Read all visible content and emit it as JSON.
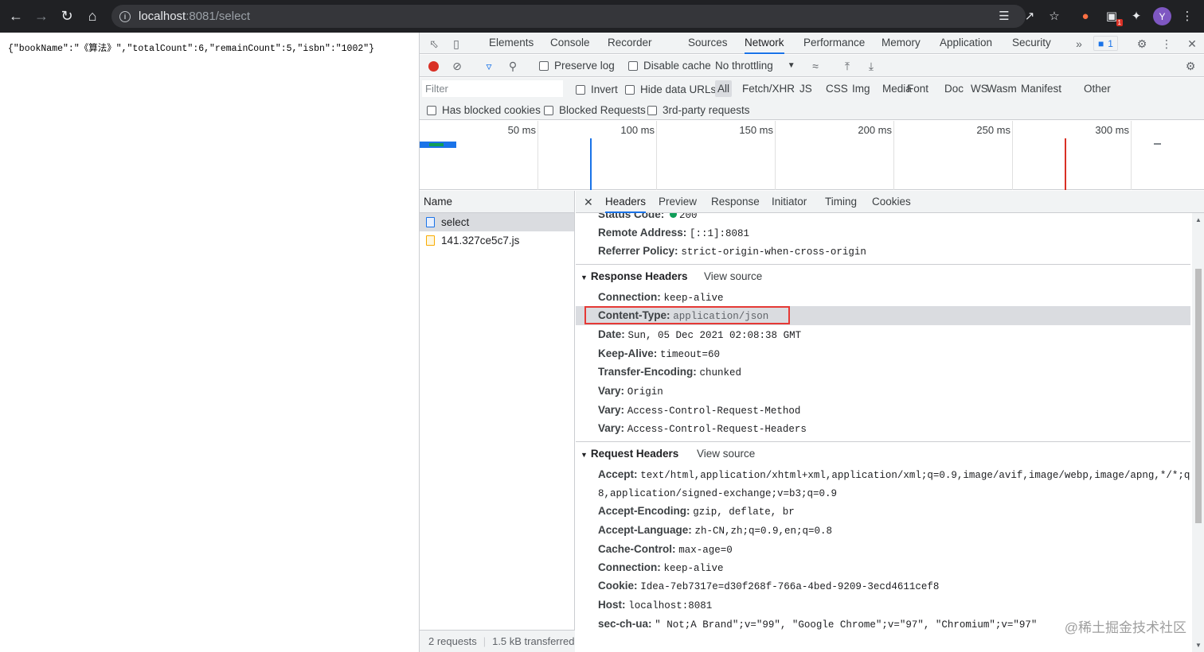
{
  "browser": {
    "url_host": "localhost",
    "url_path": ":8081/select",
    "avatar_letter": "Y",
    "ext_badge": "1"
  },
  "page": {
    "json_text": "{\"bookName\":\"《算法》\",\"totalCount\":6,\"remainCount\":5,\"isbn\":\"1002\"}"
  },
  "devtools": {
    "tabs": [
      "Elements",
      "Console",
      "Recorder",
      "Sources",
      "Network",
      "Performance",
      "Memory",
      "Application",
      "Security"
    ],
    "active_tab": "Network",
    "issues_count": "1",
    "toolbar": {
      "preserve_log": "Preserve log",
      "disable_cache": "Disable cache",
      "throttling": "No throttling"
    },
    "filter": {
      "placeholder": "Filter",
      "invert": "Invert",
      "hide_data_urls": "Hide data URLs",
      "types": [
        "All",
        "Fetch/XHR",
        "JS",
        "CSS",
        "Img",
        "Media",
        "Font",
        "Doc",
        "WS",
        "Wasm",
        "Manifest",
        "Other"
      ],
      "selected_type": "All",
      "has_blocked_cookies": "Has blocked cookies",
      "blocked_requests": "Blocked Requests",
      "third_party": "3rd-party requests"
    },
    "timeline_ticks": [
      "50 ms",
      "100 ms",
      "150 ms",
      "200 ms",
      "250 ms",
      "300 ms"
    ],
    "requests": {
      "column": "Name",
      "items": [
        {
          "name": "select",
          "type": "doc"
        },
        {
          "name": "141.327ce5c7.js",
          "type": "js"
        }
      ],
      "count": "2 requests",
      "transferred": "1.5 kB transferred"
    },
    "details": {
      "tabs": [
        "Headers",
        "Preview",
        "Response",
        "Initiator",
        "Timing",
        "Cookies"
      ],
      "active_tab": "Headers",
      "general": [
        {
          "k": "Status Code:",
          "v": "200"
        },
        {
          "k": "Remote Address:",
          "v": "[::1]:8081"
        },
        {
          "k": "Referrer Policy:",
          "v": "strict-origin-when-cross-origin"
        }
      ],
      "response_headers_title": "Response Headers",
      "request_headers_title": "Request Headers",
      "view_source": "View source",
      "response_headers": [
        {
          "k": "Connection:",
          "v": "keep-alive"
        },
        {
          "k": "Content-Type:",
          "v": "application/json"
        },
        {
          "k": "Date:",
          "v": "Sun, 05 Dec 2021 02:08:38 GMT"
        },
        {
          "k": "Keep-Alive:",
          "v": "timeout=60"
        },
        {
          "k": "Transfer-Encoding:",
          "v": "chunked"
        },
        {
          "k": "Vary:",
          "v": "Origin"
        },
        {
          "k": "Vary:",
          "v": "Access-Control-Request-Method"
        },
        {
          "k": "Vary:",
          "v": "Access-Control-Request-Headers"
        }
      ],
      "request_headers": [
        {
          "k": "Accept:",
          "v": "text/html,application/xhtml+xml,application/xml;q=0.9,image/avif,image/webp,image/apng,*/*;q=0."
        },
        {
          "k": "",
          "v": "8,application/signed-exchange;v=b3;q=0.9"
        },
        {
          "k": "Accept-Encoding:",
          "v": "gzip, deflate, br"
        },
        {
          "k": "Accept-Language:",
          "v": "zh-CN,zh;q=0.9,en;q=0.8"
        },
        {
          "k": "Cache-Control:",
          "v": "max-age=0"
        },
        {
          "k": "Connection:",
          "v": "keep-alive"
        },
        {
          "k": "Cookie:",
          "v": "Idea-7eb7317e=d30f268f-766a-4bed-9209-3ecd4611cef8"
        },
        {
          "k": "Host:",
          "v": "localhost:8081"
        },
        {
          "k": "sec-ch-ua:",
          "v": "\" Not;A Brand\";v=\"99\", \"Google Chrome\";v=\"97\", \"Chromium\";v=\"97\""
        }
      ]
    }
  },
  "watermark": "@稀土掘金技术社区",
  "colors": {
    "accent": "#1a73e8",
    "record": "#d93025",
    "highlight": "#e53935",
    "status_ok": "#0f9d58"
  }
}
